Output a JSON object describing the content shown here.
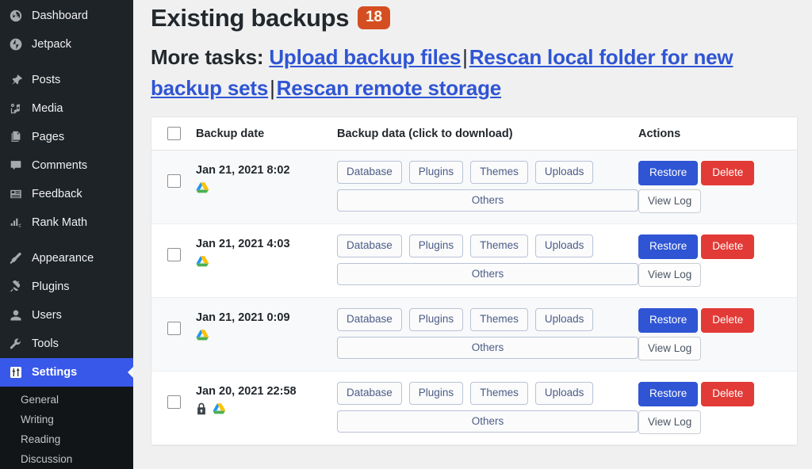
{
  "sidebar": {
    "items": [
      {
        "label": "Dashboard",
        "icon": "dashboard-icon",
        "name": "dashboard"
      },
      {
        "label": "Jetpack",
        "icon": "jetpack-icon",
        "name": "jetpack"
      },
      {
        "label": "Posts",
        "icon": "pin-icon",
        "name": "posts"
      },
      {
        "label": "Media",
        "icon": "media-icon",
        "name": "media"
      },
      {
        "label": "Pages",
        "icon": "pages-icon",
        "name": "pages"
      },
      {
        "label": "Comments",
        "icon": "comment-icon",
        "name": "comments"
      },
      {
        "label": "Feedback",
        "icon": "feedback-icon",
        "name": "feedback"
      },
      {
        "label": "Rank Math",
        "icon": "chart-bars-icon",
        "name": "rank-math"
      },
      {
        "label": "Appearance",
        "icon": "brush-icon",
        "name": "appearance"
      },
      {
        "label": "Plugins",
        "icon": "plug-icon",
        "name": "plugins"
      },
      {
        "label": "Users",
        "icon": "user-icon",
        "name": "users"
      },
      {
        "label": "Tools",
        "icon": "wrench-icon",
        "name": "tools"
      },
      {
        "label": "Settings",
        "icon": "sliders-icon",
        "name": "settings",
        "current": true
      }
    ],
    "submenu": [
      {
        "label": "General"
      },
      {
        "label": "Writing"
      },
      {
        "label": "Reading"
      },
      {
        "label": "Discussion"
      }
    ]
  },
  "header": {
    "title": "Existing backups",
    "count": "18",
    "badge_color": "#d54e21",
    "more_tasks_label": "More tasks:",
    "links": [
      {
        "label": "Upload backup files"
      },
      {
        "label": "Rescan local folder for new backup sets"
      },
      {
        "label": "Rescan remote storage"
      }
    ],
    "separator": "|"
  },
  "table": {
    "columns": [
      {
        "label": "Backup date"
      },
      {
        "label": "Backup data (click to download)"
      },
      {
        "label": "Actions"
      }
    ],
    "data_buttons": [
      "Database",
      "Plugins",
      "Themes",
      "Uploads",
      "Others"
    ],
    "action_labels": {
      "restore": "Restore",
      "delete": "Delete",
      "view_log": "View Log"
    },
    "action_colors": {
      "restore": "#2f55d4",
      "delete": "#e23a36"
    },
    "rows": [
      {
        "date": "Jan 21, 2021 8:02",
        "icons": [
          "google-drive-icon"
        ],
        "data_buttons": [
          "Database",
          "Plugins",
          "Themes",
          "Uploads",
          "Others"
        ]
      },
      {
        "date": "Jan 21, 2021 4:03",
        "icons": [
          "google-drive-icon"
        ],
        "data_buttons": [
          "Database",
          "Plugins",
          "Themes",
          "Uploads",
          "Others"
        ]
      },
      {
        "date": "Jan 21, 2021 0:09",
        "icons": [
          "google-drive-icon"
        ],
        "data_buttons": [
          "Database",
          "Plugins",
          "Themes",
          "Uploads",
          "Others"
        ]
      },
      {
        "date": "Jan 20, 2021 22:58",
        "icons": [
          "lock-icon",
          "google-drive-icon"
        ],
        "data_buttons": [
          "Database",
          "Plugins",
          "Themes",
          "Uploads",
          "Others"
        ]
      }
    ]
  }
}
